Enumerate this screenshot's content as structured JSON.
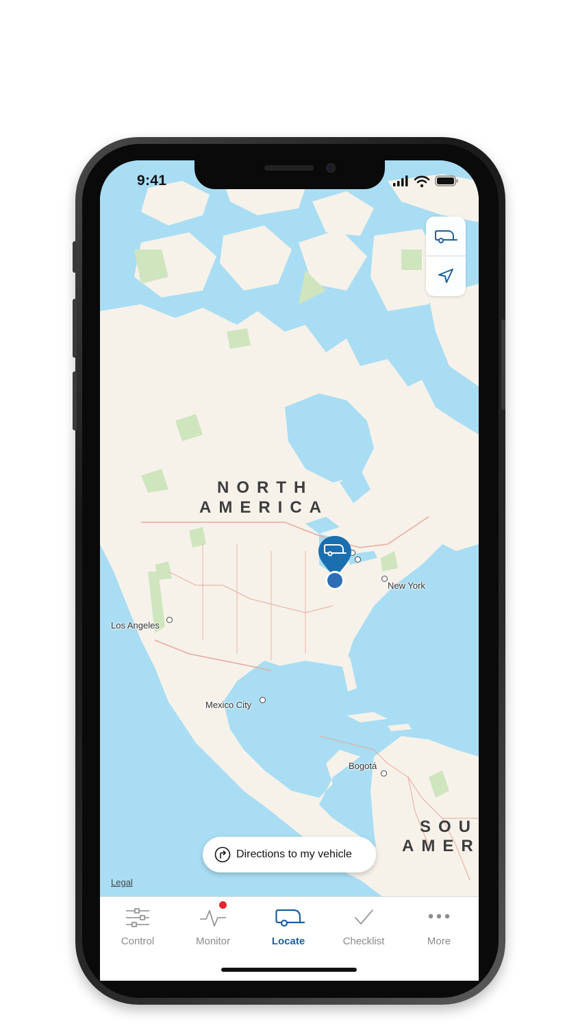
{
  "status_bar": {
    "time": "9:41"
  },
  "map": {
    "continents": [
      "NORTH",
      "AMERICA",
      "SOU",
      "AMER"
    ],
    "cities": [
      "New York",
      "Los Angeles",
      "Mexico City",
      "Bogotá"
    ],
    "legal_label": "Legal",
    "controls": {
      "vehicle_icon": "trailer-icon",
      "location_icon": "location-arrow-icon"
    },
    "pin_icon": "trailer-pin-icon"
  },
  "directions_button": {
    "label": "Directions to my vehicle",
    "icon": "turn-right-icon"
  },
  "tabbar": {
    "tabs": [
      {
        "label": "Control",
        "icon": "sliders-icon",
        "active": false
      },
      {
        "label": "Monitor",
        "icon": "pulse-icon",
        "active": false,
        "badge": true
      },
      {
        "label": "Locate",
        "icon": "trailer-icon",
        "active": true
      },
      {
        "label": "Checklist",
        "icon": "checkmark-icon",
        "active": false
      },
      {
        "label": "More",
        "icon": "more-dots-icon",
        "active": false
      }
    ]
  },
  "colors": {
    "accent": "#1a5fa0",
    "water": "#a9ddf3",
    "land": "#f6f2ea",
    "park": "#cfe5be",
    "badge": "#e4262b",
    "border_lines": "#e8a89a"
  }
}
